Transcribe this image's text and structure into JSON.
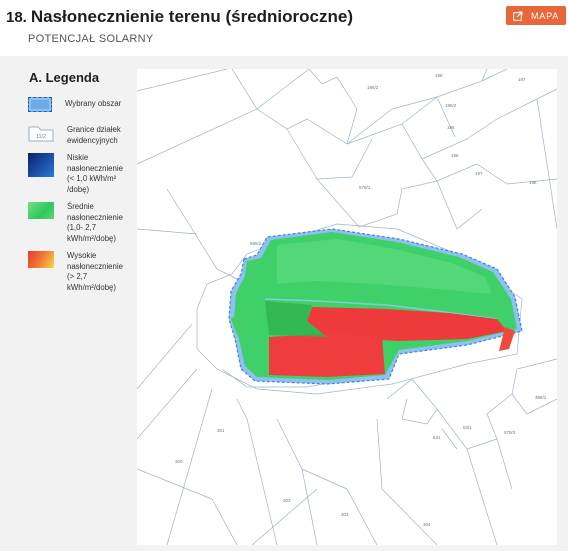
{
  "header": {
    "section_number": "18.",
    "title": "Nasłonecznienie terenu (średnioroczne)",
    "subtitle": "POTENCJAŁ SOLARNY",
    "map_button_label": "MAPA"
  },
  "legend": {
    "title": "A. Legenda",
    "items": [
      {
        "label": "Wybrany obszar"
      },
      {
        "label": "Granice działek ewidencyjnych",
        "swatch_label": "11/2"
      },
      {
        "label_lines": [
          "Niskie",
          "nasłonecznienie",
          "(< 1,0 kWh/m²",
          "/dobę)"
        ]
      },
      {
        "label_lines": [
          "Średnie",
          "nasłonecznienie",
          "(1,0- 2,7",
          "kWh/m²/dobę)"
        ]
      },
      {
        "label_lines": [
          "Wysokie",
          "nasłonecznienie",
          "(> 2,7",
          "kWh/m²/dobę)"
        ]
      }
    ]
  },
  "map": {
    "parcel_labels": [
      "198",
      "195/2",
      "197",
      "196",
      "195/2",
      "199",
      "196",
      "197",
      "198",
      "578/1",
      "595/2",
      "577/3",
      "579/3",
      "386/1",
      "301",
      "300",
      "302",
      "303",
      "304",
      "531",
      "63/1"
    ],
    "colors": {
      "low": "#1b3fa0",
      "medium": "#3fd06a",
      "high": "#ee3a3a",
      "selected_outline": "#4a8ee0",
      "parcel_lines": "#8ea6bd"
    }
  }
}
